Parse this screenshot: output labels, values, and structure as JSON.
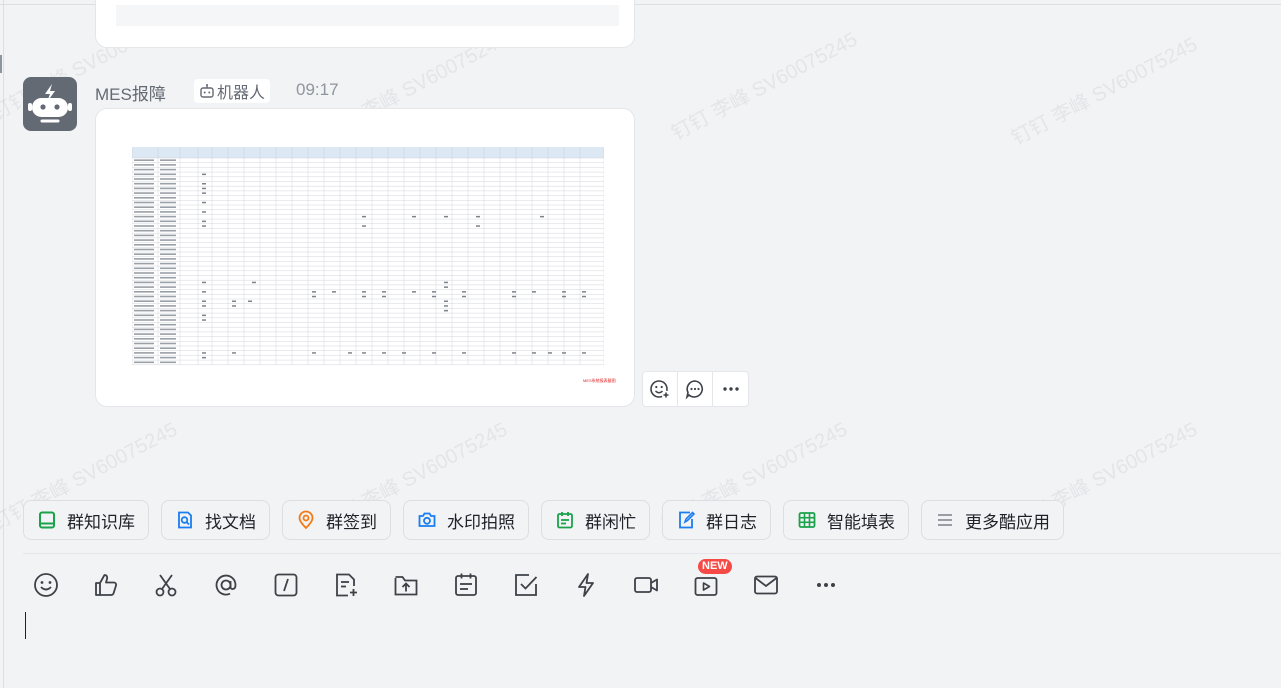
{
  "watermark": "钉钉 李峰 SV60075245",
  "message": {
    "sender": "MES报障",
    "tag": "机器人",
    "time": "09:17",
    "sheet_note": "MES系统报表截图"
  },
  "message_actions": [
    {
      "name": "add-reaction",
      "icon": "emoji-plus-icon"
    },
    {
      "name": "reply",
      "icon": "comment-icon"
    },
    {
      "name": "more",
      "icon": "more-icon"
    }
  ],
  "apps": [
    {
      "label": "群知识库",
      "icon": "book-icon",
      "color": "#1aa34a"
    },
    {
      "label": "找文档",
      "icon": "doc-search-icon",
      "color": "#1a7df0"
    },
    {
      "label": "群签到",
      "icon": "location-icon",
      "color": "#f57a13"
    },
    {
      "label": "水印拍照",
      "icon": "camera-icon",
      "color": "#1a7df0"
    },
    {
      "label": "群闲忙",
      "icon": "calendar-icon",
      "color": "#1aa34a"
    },
    {
      "label": "群日志",
      "icon": "journal-icon",
      "color": "#1a7df0"
    },
    {
      "label": "智能填表",
      "icon": "table-icon",
      "color": "#1aa34a"
    },
    {
      "label": "更多酷应用",
      "icon": "menu-icon",
      "color": "#8f959e"
    }
  ],
  "toolbar": {
    "new_badge": "NEW",
    "items": [
      "emoji-icon",
      "thumbs-up-icon",
      "scissors-icon",
      "at-icon",
      "slash-command-icon",
      "new-doc-icon",
      "upload-icon",
      "schedule-icon",
      "task-check-icon",
      "flash-icon",
      "video-icon",
      "live-icon",
      "mail-icon",
      "more-icon"
    ]
  }
}
